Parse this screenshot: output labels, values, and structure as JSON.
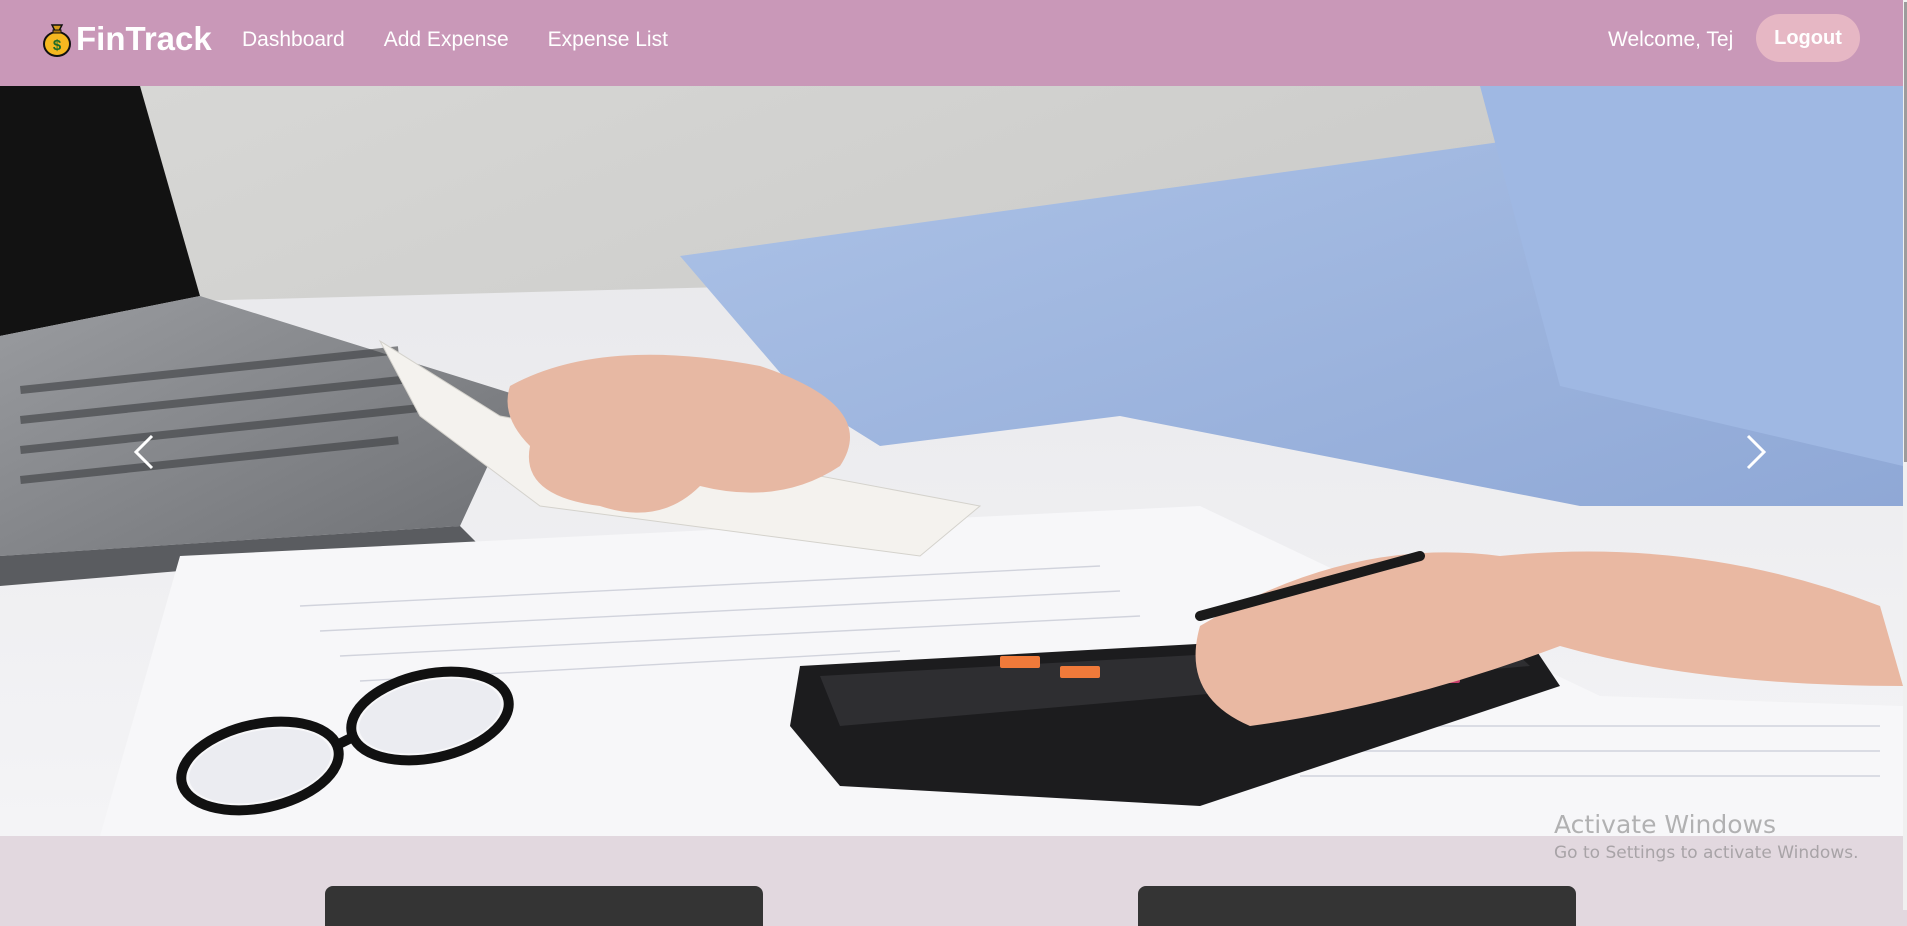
{
  "brand": {
    "name": "FinTrack",
    "icon": "money-bag-icon"
  },
  "nav": {
    "links": [
      {
        "label": "Dashboard"
      },
      {
        "label": "Add Expense"
      },
      {
        "label": "Expense List"
      }
    ],
    "welcome": "Welcome, Tej",
    "logout_label": "Logout"
  },
  "hero": {
    "image_subject": "hands using calculator with receipt, laptop and glasses on desk",
    "prev_icon": "chevron-left-icon",
    "next_icon": "chevron-right-icon"
  },
  "windows_watermark": {
    "title": "Activate Windows",
    "subtitle": "Go to Settings to activate Windows."
  },
  "colors": {
    "navbar": "#c998b8",
    "logout_button": "#e6b7c4",
    "page_background": "#e2d8df",
    "card": "#343434"
  }
}
